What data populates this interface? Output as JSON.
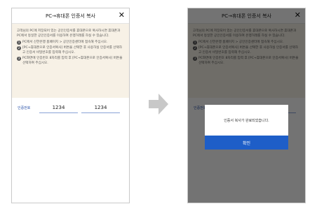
{
  "dialog": {
    "title": "PC→휴대폰 인증서 복사",
    "close_glyph": "✕",
    "intro": "고객님의 PC에 저장되어 있는 공인인증서를 휴대폰으로 복사하시면 휴대폰과 PC에서 동일한 공인인증서를 이용하여 은행거래를 하실 수 있습니다.",
    "steps": [
      {
        "num": "1",
        "text": "PC에서 신한은행 홈페이지 > 공인인증센터에 접속해 주십시오."
      },
      {
        "num": "2",
        "text": "[PC→휴대폰으로 인증서복사] 버튼을 선택한 후 사용하실 인증서를 선택하고 인증서 비밀번호를 입력해 주십시오."
      },
      {
        "num": "3",
        "text": "PC화면에 인증번호 8자리를 입력 후 [PC→휴대폰으로 인증서복사] 버튼을 선택하여 주십시오."
      }
    ],
    "cert_label": "인증번호",
    "cert_values": [
      "1234",
      "1234"
    ]
  },
  "modal": {
    "message": "인증서 복사가 완료되었습니다.",
    "confirm_label": "확인"
  },
  "colors": {
    "accent_blue": "#1e5ec8",
    "info_bg": "#f7f1e6",
    "arrow": "#c8c8c8"
  },
  "icons": [
    "close-icon",
    "arrow-right-icon"
  ]
}
